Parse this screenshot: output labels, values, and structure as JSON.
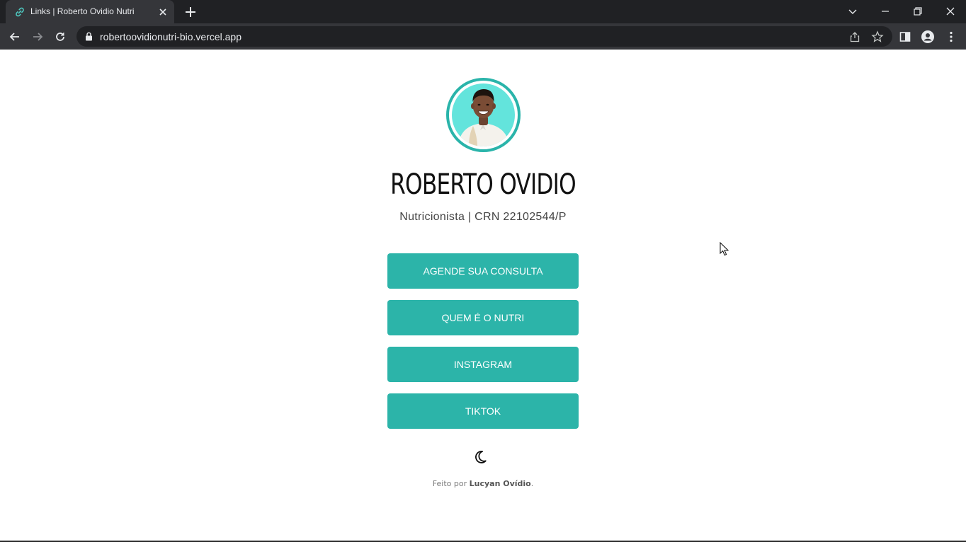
{
  "browser": {
    "tab_title": "Links | Roberto Ovidio Nutri",
    "url": "robertoovidionutri-bio.vercel.app"
  },
  "profile": {
    "name": "ROBERTO OVIDIO",
    "subtitle": "Nutricionista | CRN 22102544/P"
  },
  "links": [
    {
      "label": "AGENDE SUA CONSULTA"
    },
    {
      "label": "QUEM É O NUTRI"
    },
    {
      "label": "INSTAGRAM"
    },
    {
      "label": "TIKTOK"
    }
  ],
  "theme_toggle_icon": "moon-icon",
  "footer": {
    "prefix": "Feito por",
    "author": "Lucyan Ovídio",
    "suffix": "."
  },
  "colors": {
    "accent": "#2cb4a9",
    "avatar_bg": "#63e4dc",
    "chrome_dark": "#202124",
    "chrome_toolbar": "#35363a"
  }
}
